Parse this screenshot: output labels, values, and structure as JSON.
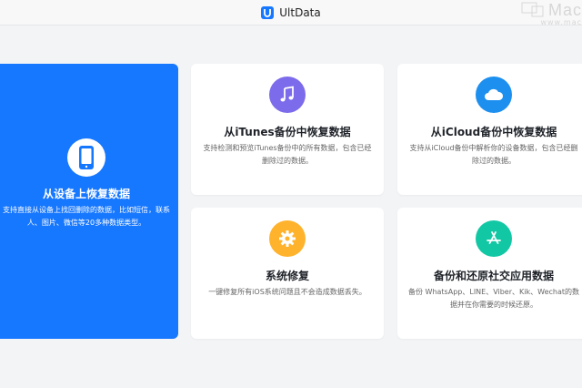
{
  "window": {
    "title": "UltData"
  },
  "watermark": {
    "text": "Mac",
    "sub": "www.mac"
  },
  "cards": {
    "device": {
      "title": "从设备上恢复数据",
      "desc": "支持直接从设备上找回删除的数据，比如短信，联系人、图片、微信等20多种数据类型。",
      "icon": "phone-icon",
      "color": "#1677ff"
    },
    "itunes": {
      "title": "从iTunes备份中恢复数据",
      "desc": "支持检测和预览iTunes备份中的所有数据，包含已经删除过的数据。",
      "icon": "music-note-icon",
      "color": "#7c6bea"
    },
    "icloud": {
      "title": "从iCloud备份中恢复数据",
      "desc": "支持从iCloud备份中解析你的设备数据，包含已经删除过的数据。",
      "icon": "cloud-icon",
      "color": "#1c8fef"
    },
    "repair": {
      "title": "系统修复",
      "desc": "一键修复所有iOS系统问题且不会造成数据丢失。",
      "icon": "gear-icon",
      "color": "#ffb22c"
    },
    "social": {
      "title": "备份和还原社交应用数据",
      "desc": "备份 WhatsApp、LINE、Viber、Kik、Wechat的数据并在你需要的时候还原。",
      "icon": "app-store-icon",
      "color": "#12c8a4"
    }
  }
}
